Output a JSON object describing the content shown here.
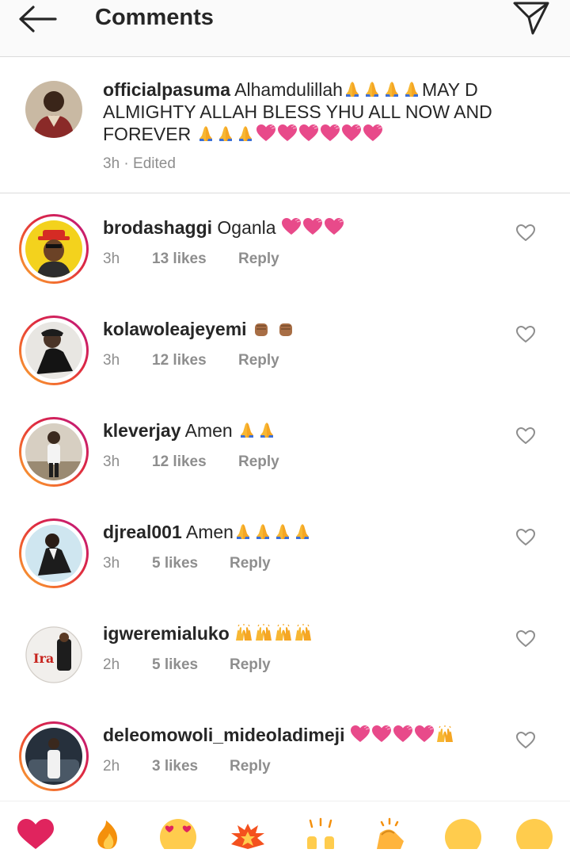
{
  "header": {
    "title": "Comments"
  },
  "caption": {
    "username": "officialpasuma",
    "text": "Alhamdulillah",
    "text2": "MAY D ALMIGHTY ALLAH BLESS YHU ALL NOW AND FOREVER",
    "time": "3h",
    "edited": "· Edited"
  },
  "comments": [
    {
      "username": "brodashaggi",
      "text": "Oganla",
      "emojis": "💖💖💖",
      "time": "3h",
      "likes": "13 likes",
      "reply": "Reply"
    },
    {
      "username": "kolawoleajeyemi",
      "text": "",
      "emojis": "✊🏽✊🏽",
      "time": "3h",
      "likes": "12 likes",
      "reply": "Reply"
    },
    {
      "username": "kleverjay",
      "text": "Amen",
      "emojis": "🙏🙏",
      "time": "3h",
      "likes": "12 likes",
      "reply": "Reply"
    },
    {
      "username": "djreal001",
      "text": "Amen",
      "emojis": "🙏🙏🙏🙏",
      "time": "3h",
      "likes": "5 likes",
      "reply": "Reply"
    },
    {
      "username": "igweremialuko",
      "text": "",
      "emojis": "🙌🙌🙌🙌",
      "time": "2h",
      "likes": "5 likes",
      "reply": "Reply"
    },
    {
      "username": "deleomowoli_mideoladimeji",
      "text": "",
      "emojis": "💖💖💖💖🙌",
      "time": "2h",
      "likes": "3 likes",
      "reply": "Reply"
    }
  ],
  "emoji_bar": [
    "heart-emoji",
    "fire-emoji",
    "heart-eyes-emoji",
    "explosion-emoji",
    "raised-hands-emoji",
    "clapping-emoji",
    "smile-emoji",
    "grin-emoji"
  ],
  "colors": {
    "heart": "#e84a8a",
    "pray": "#f7b733",
    "muted": "#8e8e8e"
  }
}
